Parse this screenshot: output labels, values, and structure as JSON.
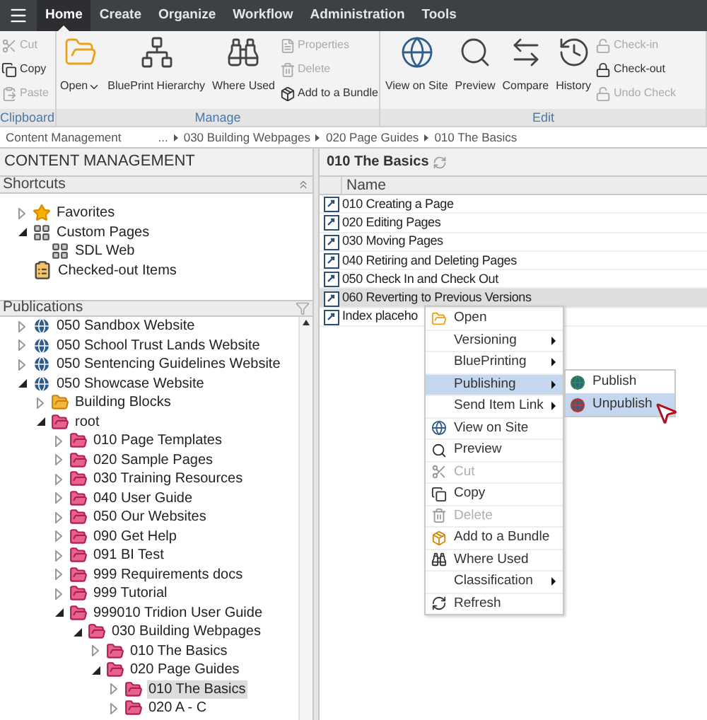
{
  "menu_bar": {
    "tabs": [
      {
        "label": "Home",
        "selected": true
      },
      {
        "label": "Create",
        "selected": false
      },
      {
        "label": "Organize",
        "selected": false
      },
      {
        "label": "Workflow",
        "selected": false
      },
      {
        "label": "Administration",
        "selected": false
      },
      {
        "label": "Tools",
        "selected": false
      }
    ]
  },
  "ribbon": {
    "groups": [
      {
        "label": "Clipboard",
        "items": [
          {
            "label": "Cut",
            "kind": "small",
            "disabled": true
          },
          {
            "label": "Copy",
            "kind": "small",
            "disabled": false
          },
          {
            "label": "Paste",
            "kind": "small",
            "disabled": true
          }
        ]
      },
      {
        "label": "Manage",
        "items": [
          {
            "label": "Open",
            "kind": "dropdown",
            "disabled": false
          },
          {
            "label": "BluePrint Hierarchy",
            "kind": "large",
            "disabled": false
          },
          {
            "label": "Where Used",
            "kind": "large",
            "disabled": false
          },
          {
            "label": "Properties",
            "kind": "small",
            "disabled": true
          },
          {
            "label": "Delete",
            "kind": "small",
            "disabled": true
          },
          {
            "label": "Add to a Bundle",
            "kind": "small",
            "disabled": false
          }
        ]
      },
      {
        "label": "Edit",
        "items": [
          {
            "label": "View on Site",
            "kind": "large",
            "disabled": false
          },
          {
            "label": "Preview",
            "kind": "large",
            "disabled": false
          },
          {
            "label": "Compare",
            "kind": "large",
            "disabled": false
          },
          {
            "label": "History",
            "kind": "large",
            "disabled": false
          },
          {
            "label": "Check-in",
            "kind": "small",
            "disabled": true
          },
          {
            "label": "Check-out",
            "kind": "small",
            "disabled": false
          },
          {
            "label": "Undo Check",
            "kind": "small",
            "disabled": true
          }
        ]
      }
    ]
  },
  "breadcrumb": [
    "Content Management",
    "...",
    "030 Building Webpages",
    "020 Page Guides",
    "010 The Basics"
  ],
  "left_panel": {
    "title": "CONTENT MANAGEMENT",
    "shortcuts": {
      "title": "Shortcuts",
      "items": [
        {
          "label": "Favorites",
          "kind": "favorites",
          "expanded": false,
          "selected": false
        },
        {
          "label": "Custom Pages",
          "kind": "custompages",
          "expanded": true,
          "selected": false,
          "children": [
            {
              "label": "SDL Web",
              "kind": "custompages",
              "selected": false
            }
          ]
        },
        {
          "label": "Checked-out Items",
          "kind": "checkedout",
          "selected": false
        }
      ]
    },
    "publications": {
      "title": "Publications",
      "items": [
        {
          "label": "050 Sandbox Website",
          "kind": "publication",
          "expanded": false,
          "selected": false
        },
        {
          "label": "050 School Trust Lands Website",
          "kind": "publication",
          "expanded": false,
          "selected": false
        },
        {
          "label": "050 Sentencing Guidelines Website",
          "kind": "publication",
          "expanded": false,
          "selected": false
        },
        {
          "label": "050 Showcase Website",
          "kind": "publication",
          "expanded": true,
          "selected": false,
          "children": [
            {
              "label": "Building Blocks",
              "kind": "folder",
              "expanded": false,
              "selected": false
            },
            {
              "label": "root",
              "kind": "group",
              "expanded": true,
              "selected": false,
              "children": [
                {
                  "label": "010 Page Templates",
                  "kind": "group",
                  "expanded": false,
                  "selected": false
                },
                {
                  "label": "020 Sample Pages",
                  "kind": "group",
                  "expanded": false,
                  "selected": false
                },
                {
                  "label": "030 Training Resources",
                  "kind": "group",
                  "expanded": false,
                  "selected": false
                },
                {
                  "label": "040 User Guide",
                  "kind": "group",
                  "expanded": false,
                  "selected": false
                },
                {
                  "label": "050 Our Websites",
                  "kind": "group",
                  "expanded": false,
                  "selected": false
                },
                {
                  "label": "090 Get Help",
                  "kind": "group",
                  "expanded": false,
                  "selected": false
                },
                {
                  "label": "091 BI Test",
                  "kind": "group",
                  "expanded": false,
                  "selected": false
                },
                {
                  "label": "999 Requirements docs",
                  "kind": "group",
                  "expanded": false,
                  "selected": false
                },
                {
                  "label": "999 Tutorial",
                  "kind": "group",
                  "expanded": false,
                  "selected": false
                },
                {
                  "label": "999010 Tridion User Guide",
                  "kind": "group",
                  "expanded": true,
                  "selected": false,
                  "children": [
                    {
                      "label": "030 Building Webpages",
                      "kind": "group",
                      "expanded": true,
                      "selected": false,
                      "children": [
                        {
                          "label": "010 The Basics",
                          "kind": "group",
                          "expanded": false,
                          "selected": false
                        },
                        {
                          "label": "020 Page Guides",
                          "kind": "group",
                          "expanded": true,
                          "selected": false,
                          "children": [
                            {
                              "label": "010 The Basics",
                              "kind": "group",
                              "expanded": false,
                              "selected": true
                            },
                            {
                              "label": "020 A - C",
                              "kind": "group",
                              "expanded": false,
                              "selected": false
                            }
                          ]
                        }
                      ]
                    }
                  ]
                }
              ]
            }
          ]
        }
      ]
    }
  },
  "list": {
    "title": "010 The Basics",
    "columns": [
      "Name"
    ],
    "rows": [
      {
        "name": "010 Creating a Page",
        "selected": false
      },
      {
        "name": "020 Editing Pages",
        "selected": false
      },
      {
        "name": "030 Moving Pages",
        "selected": false
      },
      {
        "name": "040 Retiring and Deleting Pages",
        "selected": false
      },
      {
        "name": "050 Check In and Check Out",
        "selected": false
      },
      {
        "name": "060 Reverting to Previous Versions",
        "selected": true
      },
      {
        "name": "Index placeho",
        "selected": false
      }
    ]
  },
  "context_menu": {
    "items": [
      {
        "label": "Open",
        "submenu": false,
        "disabled": false,
        "selected": false
      },
      {
        "label": "Versioning",
        "submenu": true,
        "disabled": false,
        "selected": false
      },
      {
        "label": "BluePrinting",
        "submenu": true,
        "disabled": false,
        "selected": false
      },
      {
        "label": "Publishing",
        "submenu": true,
        "disabled": false,
        "selected": true
      },
      {
        "label": "Send Item Link",
        "submenu": true,
        "disabled": false,
        "selected": false
      },
      {
        "label": "View on Site",
        "submenu": false,
        "disabled": false,
        "selected": false
      },
      {
        "label": "Preview",
        "submenu": false,
        "disabled": false,
        "selected": false
      },
      {
        "label": "Cut",
        "submenu": false,
        "disabled": true,
        "selected": false
      },
      {
        "label": "Copy",
        "submenu": false,
        "disabled": false,
        "selected": false
      },
      {
        "label": "Delete",
        "submenu": false,
        "disabled": true,
        "selected": false
      },
      {
        "label": "Add to a Bundle",
        "submenu": false,
        "disabled": false,
        "selected": false
      },
      {
        "label": "Where Used",
        "submenu": false,
        "disabled": false,
        "selected": false
      },
      {
        "label": "Classification",
        "submenu": true,
        "disabled": false,
        "selected": false
      },
      {
        "label": "Refresh",
        "submenu": false,
        "disabled": false,
        "selected": false
      }
    ]
  },
  "submenu": {
    "items": [
      {
        "label": "Publish",
        "selected": false
      },
      {
        "label": "Unpublish",
        "selected": true
      }
    ]
  }
}
